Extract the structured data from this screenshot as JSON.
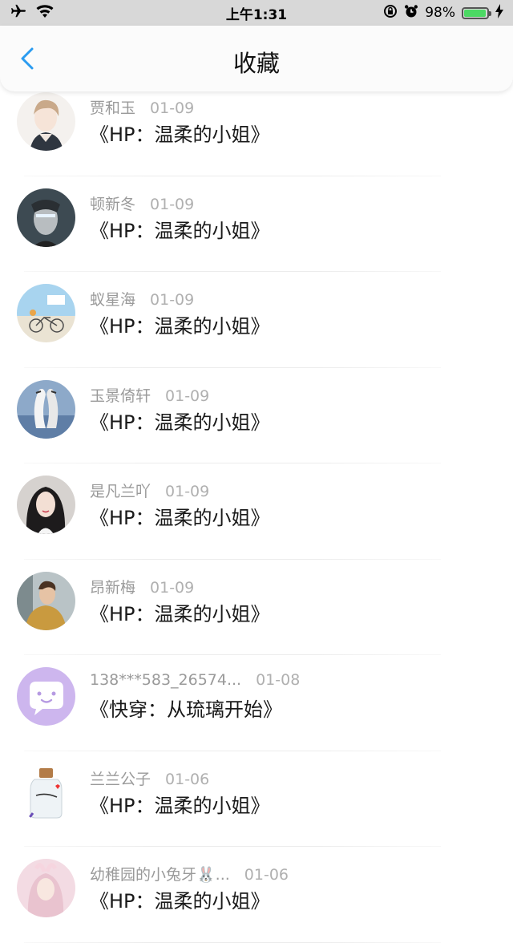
{
  "status_bar": {
    "time": "上午1:31",
    "battery_percent": "98%",
    "battery_level": 0.98,
    "icons": [
      "airplane-icon",
      "wifi-icon",
      "rotation-lock-icon",
      "alarm-icon",
      "battery-icon",
      "charging-icon"
    ]
  },
  "navbar": {
    "title": "收藏",
    "back_icon": "chevron-left-icon"
  },
  "colors": {
    "accent": "#2a9bf0",
    "status_bar_bg": "#d8d8d8",
    "battery_green": "#4cd964",
    "meta_text": "#9a9a9a"
  },
  "items": [
    {
      "user": "贾和玉",
      "date": "01-09",
      "book": "《HP：温柔的小姐》"
    },
    {
      "user": "顿新冬",
      "date": "01-09",
      "book": "《HP：温柔的小姐》"
    },
    {
      "user": "蚁星海",
      "date": "01-09",
      "book": "《HP：温柔的小姐》"
    },
    {
      "user": "玉景倚轩",
      "date": "01-09",
      "book": "《HP：温柔的小姐》"
    },
    {
      "user": "是凡兰吖",
      "date": "01-09",
      "book": "《HP：温柔的小姐》"
    },
    {
      "user": "昂新梅",
      "date": "01-09",
      "book": "《HP：温柔的小姐》"
    },
    {
      "user": "138***583_26574...",
      "date": "01-08",
      "book": "《快穿：从琉璃开始》"
    },
    {
      "user": "兰兰公子",
      "date": "01-06",
      "book": "《HP：温柔的小姐》"
    },
    {
      "user": "幼稚园的小兔牙🐰...",
      "date": "01-06",
      "book": "《HP：温柔的小姐》"
    }
  ]
}
